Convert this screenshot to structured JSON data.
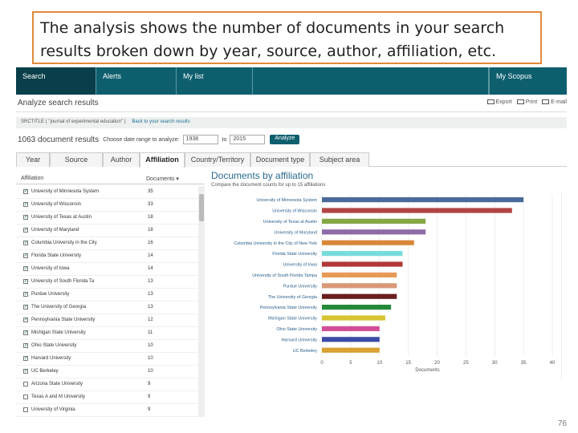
{
  "callout": {
    "text": "The analysis shows the number of documents in your search results broken down by year, source, author, affiliation, etc."
  },
  "nav": {
    "search": "Search",
    "alerts": "Alerts",
    "mylist": "My list",
    "myscopus": "My Scopus"
  },
  "page": {
    "title": "Analyze search results",
    "actions": {
      "export": "Export",
      "print": "Print",
      "email": "E-mail"
    },
    "query": "SRCTITLE ( \"journal of experimental education\" )",
    "back_link": "Back to your search results",
    "results_count": "1063",
    "results_label": "document results",
    "range_label": "Choose date range to analyze:",
    "range_from": "1938",
    "range_to_label": "to",
    "range_to": "2015",
    "analyze_button": "Analyze",
    "page_number": "76"
  },
  "tabs": [
    "Year",
    "Source",
    "Author",
    "Affiliation",
    "Country/Territory",
    "Document type",
    "Subject area"
  ],
  "active_tab": "Affiliation",
  "list": {
    "header_affiliation": "Affiliation",
    "header_documents": "Documents ▾",
    "rows": [
      {
        "name": "University of Minnesota System",
        "count": "35",
        "checked": true
      },
      {
        "name": "University of Wisconsin",
        "count": "33",
        "checked": true
      },
      {
        "name": "University of Texas at Austin",
        "count": "18",
        "checked": true
      },
      {
        "name": "University of Maryland",
        "count": "18",
        "checked": true
      },
      {
        "name": "Columbia University in the City",
        "count": "16",
        "checked": true
      },
      {
        "name": "Florida State University",
        "count": "14",
        "checked": true
      },
      {
        "name": "University of Iowa",
        "count": "14",
        "checked": true
      },
      {
        "name": "University of South Florida Ta",
        "count": "13",
        "checked": true
      },
      {
        "name": "Purdue University",
        "count": "13",
        "checked": true
      },
      {
        "name": "The University of Georgia",
        "count": "13",
        "checked": true
      },
      {
        "name": "Pennsylvania State University",
        "count": "12",
        "checked": true
      },
      {
        "name": "Michigan State University",
        "count": "11",
        "checked": true
      },
      {
        "name": "Ohio State University",
        "count": "10",
        "checked": true
      },
      {
        "name": "Harvard University",
        "count": "10",
        "checked": true
      },
      {
        "name": "UC Berkeley",
        "count": "10",
        "checked": true
      },
      {
        "name": "Arizona State University",
        "count": "9",
        "checked": false
      },
      {
        "name": "Texas A and M University",
        "count": "9",
        "checked": false
      },
      {
        "name": "University of Virginia",
        "count": "9",
        "checked": false
      }
    ]
  },
  "chart_data": {
    "type": "bar",
    "orientation": "horizontal",
    "title": "Documents by affiliation",
    "subtitle": "Compare the document counts for up to 15 affiliations",
    "xlabel": "Documents",
    "xlim": [
      0,
      40
    ],
    "xticks": [
      0,
      5,
      10,
      15,
      20,
      25,
      30,
      35,
      40
    ],
    "grid": true,
    "categories": [
      "University of Minnesota System",
      "University of Wisconsin",
      "University of Texas at Austin",
      "University of Maryland",
      "Columbia University in the City of New York",
      "Florida State University",
      "University of Iowa",
      "University of South Florida Tampa",
      "Purdue University",
      "The University of Georgia",
      "Pennsylvania State University",
      "Michigan State University",
      "Ohio State University",
      "Harvard University",
      "UC Berkeley"
    ],
    "values": [
      35,
      33,
      18,
      18,
      16,
      14,
      14,
      13,
      13,
      13,
      12,
      11,
      10,
      10,
      10
    ],
    "colors": [
      "#4a6a9a",
      "#b04444",
      "#86a746",
      "#8e6aa8",
      "#d7873a",
      "#76dcdc",
      "#b23838",
      "#e69a58",
      "#d89878",
      "#6a1d1d",
      "#248a3a",
      "#d6c432",
      "#d24d98",
      "#3a4aa6",
      "#d9a032"
    ]
  }
}
